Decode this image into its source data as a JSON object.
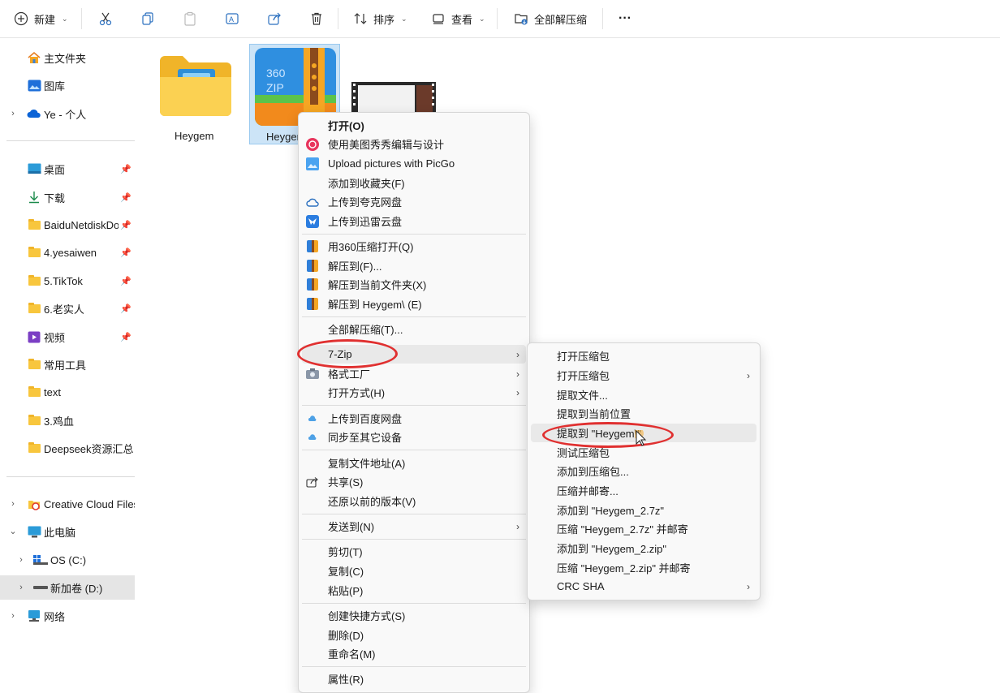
{
  "toolbar": {
    "new_label": "新建",
    "sort_label": "排序",
    "view_label": "查看",
    "extract_all_label": "全部解压缩",
    "more_label": "···"
  },
  "sidebar": {
    "top": [
      {
        "label": "主文件夹",
        "icon": "home-icon"
      },
      {
        "label": "图库",
        "icon": "gallery-icon"
      },
      {
        "label": "Ye - 个人",
        "icon": "onedrive-icon"
      }
    ],
    "pinned": [
      {
        "label": "桌面",
        "icon": "desktop-icon"
      },
      {
        "label": "下载",
        "icon": "download-icon"
      },
      {
        "label": "BaiduNetdiskDownload",
        "icon": "folder-icon"
      },
      {
        "label": "4.yesaiwen",
        "icon": "folder-icon"
      },
      {
        "label": "5.TikTok",
        "icon": "folder-icon"
      },
      {
        "label": "6.老实人",
        "icon": "folder-icon"
      },
      {
        "label": "视频",
        "icon": "video-icon"
      },
      {
        "label": "常用工具",
        "icon": "folder-icon"
      },
      {
        "label": "text",
        "icon": "folder-icon"
      },
      {
        "label": "3.鸡血",
        "icon": "folder-icon"
      },
      {
        "label": "Deepseek资源汇总",
        "icon": "folder-icon"
      }
    ],
    "drives": [
      {
        "label": "Creative Cloud Files",
        "icon": "creative-cloud-icon"
      },
      {
        "label": "此电脑",
        "icon": "pc-icon"
      },
      {
        "label": "OS (C:)",
        "icon": "drive-icon"
      },
      {
        "label": "新加卷 (D:)",
        "icon": "drive-icon"
      },
      {
        "label": "网络",
        "icon": "network-icon"
      }
    ]
  },
  "files": [
    {
      "name": "Heygem",
      "type": "folder"
    },
    {
      "name": "Heygem",
      "type": "zip"
    },
    {
      "name": "",
      "type": "video"
    }
  ],
  "context_menu": {
    "items": [
      {
        "label": "打开(O)"
      },
      {
        "label": "使用美图秀秀编辑与设计"
      },
      {
        "label": "Upload pictures with PicGo"
      },
      {
        "label": "添加到收藏夹(F)"
      },
      {
        "label": "上传到夸克网盘"
      },
      {
        "label": "上传到迅雷云盘"
      },
      {
        "label": "用360压缩打开(Q)"
      },
      {
        "label": "解压到(F)..."
      },
      {
        "label": "解压到当前文件夹(X)"
      },
      {
        "label": "解压到 Heygem\\ (E)"
      },
      {
        "label": "全部解压缩(T)..."
      },
      {
        "label": "7-Zip"
      },
      {
        "label": "格式工厂"
      },
      {
        "label": "打开方式(H)"
      },
      {
        "label": "上传到百度网盘"
      },
      {
        "label": "同步至其它设备"
      },
      {
        "label": "复制文件地址(A)"
      },
      {
        "label": "共享(S)"
      },
      {
        "label": "还原以前的版本(V)"
      },
      {
        "label": "发送到(N)"
      },
      {
        "label": "剪切(T)"
      },
      {
        "label": "复制(C)"
      },
      {
        "label": "粘贴(P)"
      },
      {
        "label": "创建快捷方式(S)"
      },
      {
        "label": "删除(D)"
      },
      {
        "label": "重命名(M)"
      },
      {
        "label": "属性(R)"
      }
    ]
  },
  "submenu": {
    "items": [
      {
        "label": "打开压缩包"
      },
      {
        "label": "打开压缩包"
      },
      {
        "label": "提取文件..."
      },
      {
        "label": "提取到当前位置"
      },
      {
        "label": "提取到 \"Heygem\\\""
      },
      {
        "label": "测试压缩包"
      },
      {
        "label": "添加到压缩包..."
      },
      {
        "label": "压缩并邮寄..."
      },
      {
        "label": "添加到 \"Heygem_2.7z\""
      },
      {
        "label": "压缩 \"Heygem_2.7z\" 并邮寄"
      },
      {
        "label": "添加到 \"Heygem_2.zip\""
      },
      {
        "label": "压缩 \"Heygem_2.zip\" 并邮寄"
      },
      {
        "label": "CRC SHA"
      }
    ]
  },
  "colors": {
    "accent": "#0067c0",
    "annotation": "#e03030",
    "highlight": "#e9e9e9"
  }
}
